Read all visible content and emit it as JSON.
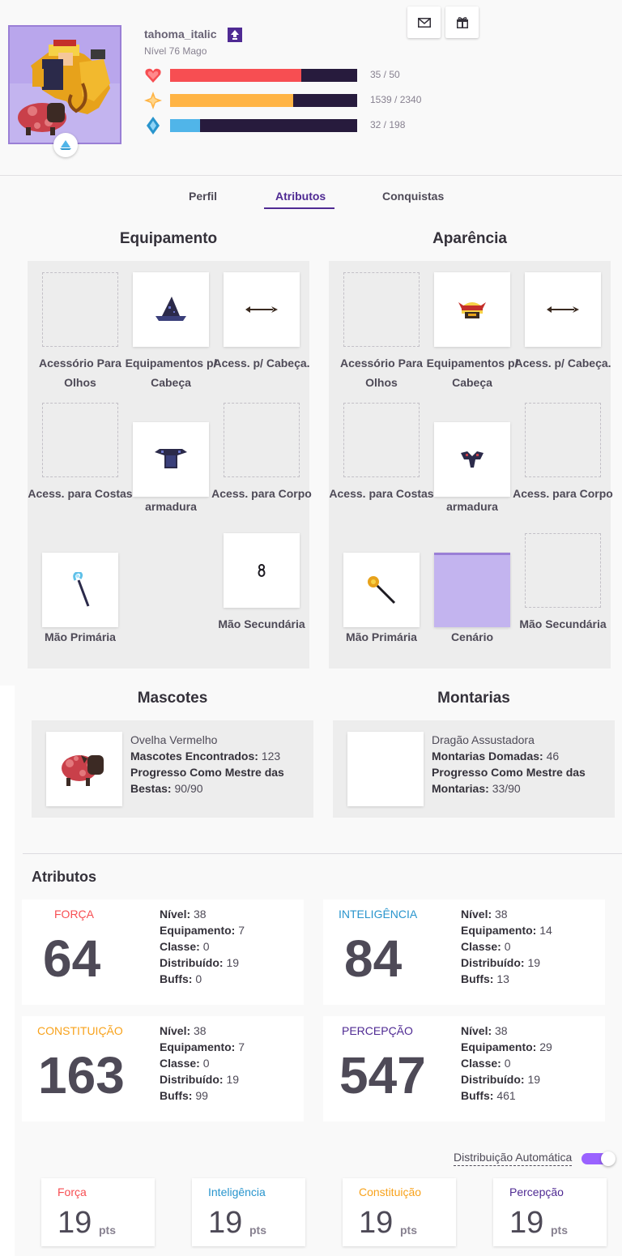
{
  "header": {
    "username": "tahoma_italic",
    "level": "Nível 76 Mago",
    "stats": [
      {
        "name": "health",
        "icon": "heart-icon",
        "value": "35 / 50",
        "fraction": 0.7,
        "color": "#f74e52"
      },
      {
        "name": "experience",
        "icon": "star-icon",
        "value": "1539 / 2340",
        "fraction": 0.658,
        "color": "#ffb445"
      },
      {
        "name": "mana",
        "icon": "mana-icon",
        "value": "32 / 198",
        "fraction": 0.162,
        "color": "#50b5e9"
      }
    ],
    "buttons": {
      "message": "envelope-icon",
      "gift": "gift-icon"
    }
  },
  "tabs": [
    "Perfil",
    "Atributos",
    "Conquistas"
  ],
  "active_tab": "Atributos",
  "equipment": {
    "title": "Equipamento",
    "slots": [
      {
        "label": "Acessório Para Olhos",
        "filled": false
      },
      {
        "label": "Equipamentos p/ Cabeça",
        "filled": true,
        "icon": "wizard-hat-icon"
      },
      {
        "label": "Acess. p/ Cabeça.",
        "filled": true,
        "icon": "arrow-icon"
      },
      {
        "label": "Acess. para Costas",
        "filled": false
      },
      {
        "label": "armadura",
        "filled": true,
        "icon": "robe-icon"
      },
      {
        "label": "Acess. para Corpo",
        "filled": false
      },
      {
        "label": "Mão Primária",
        "filled": true,
        "icon": "staff-icon"
      },
      {
        "label": "Mão Secundária",
        "filled": true,
        "icon": "orb-icon"
      }
    ]
  },
  "appearance": {
    "title": "Aparência",
    "slots": [
      {
        "label": "Acessório Para Olhos",
        "filled": false
      },
      {
        "label": "Equipamentos p/ Cabeça",
        "filled": true,
        "icon": "helmet-icon"
      },
      {
        "label": "Acess. p/ Cabeça.",
        "filled": true,
        "icon": "arrow-icon"
      },
      {
        "label": "Acess. para Costas",
        "filled": false
      },
      {
        "label": "armadura",
        "filled": true,
        "icon": "armor-icon"
      },
      {
        "label": "Acess. para Corpo",
        "filled": false
      },
      {
        "label": "Mão Primária",
        "filled": true,
        "icon": "wand-icon"
      },
      {
        "label": "Cenário",
        "filled": true,
        "icon": "background-icon"
      },
      {
        "label": "Mão Secundária",
        "filled": false
      }
    ]
  },
  "pets": {
    "title": "Mascotes",
    "name": "Ovelha Vermelho",
    "found_label": "Mascotes Encontrados:",
    "found_value": "123",
    "progress_label": "Progresso Como Mestre das Bestas:",
    "progress_value": "90/90"
  },
  "mounts": {
    "title": "Montarias",
    "name": "Dragão Assustadora",
    "found_label": "Montarias Domadas:",
    "found_value": "46",
    "progress_label": "Progresso Como Mestre das Montarias:",
    "progress_value": "33/90"
  },
  "attributes": {
    "title": "Atributos",
    "labels": {
      "level": "Nível:",
      "equipment": "Equipamento:",
      "class": "Classe:",
      "allocated": "Distribuído:",
      "buffs": "Buffs:"
    },
    "items": [
      {
        "name": "FORÇA",
        "color": "#f74e52",
        "total": "64",
        "level": "38",
        "equipment": "7",
        "class": "0",
        "allocated": "19",
        "buffs": "0"
      },
      {
        "name": "INTELIGÊNCIA",
        "color": "#2995cd",
        "total": "84",
        "level": "38",
        "equipment": "14",
        "class": "0",
        "allocated": "19",
        "buffs": "13"
      },
      {
        "name": "CONSTITUIÇÃO",
        "color": "#f8a21b",
        "total": "163",
        "level": "38",
        "equipment": "7",
        "class": "0",
        "allocated": "19",
        "buffs": "99"
      },
      {
        "name": "PERCEPÇÃO",
        "color": "#4f2a93",
        "total": "547",
        "level": "38",
        "equipment": "29",
        "class": "0",
        "allocated": "19",
        "buffs": "461"
      }
    ]
  },
  "auto_distribution": {
    "label": "Distribuição Automática",
    "enabled": true
  },
  "allocation": {
    "unit": "pts",
    "items": [
      {
        "name": "Força",
        "color": "#f74e52",
        "value": "19"
      },
      {
        "name": "Inteligência",
        "color": "#2995cd",
        "value": "19"
      },
      {
        "name": "Constituição",
        "color": "#f8a21b",
        "value": "19"
      },
      {
        "name": "Percepção",
        "color": "#4f2a93",
        "value": "19"
      }
    ]
  }
}
